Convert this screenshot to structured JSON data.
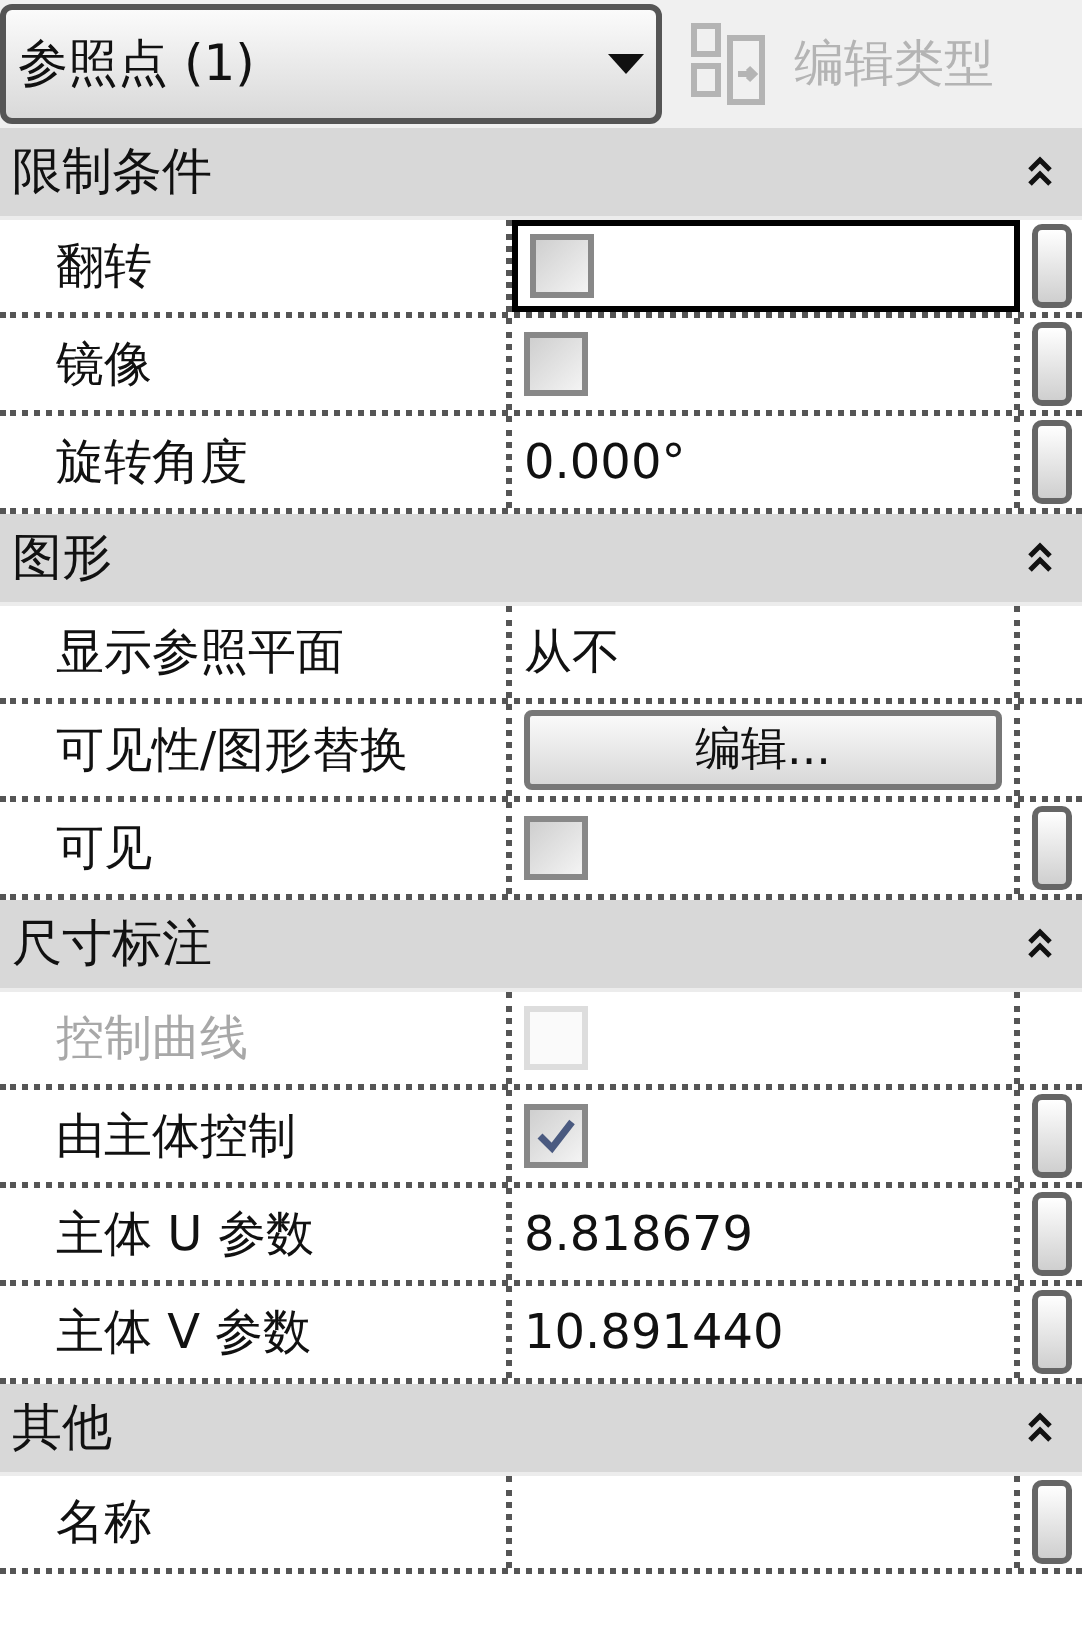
{
  "type_selector": {
    "label": "参照点 (1)"
  },
  "edit_type_button": {
    "label": "编辑类型",
    "disabled": true
  },
  "sections": [
    {
      "title": "限制条件",
      "expanded": true,
      "rows": [
        {
          "label": "翻转",
          "kind": "checkbox",
          "checked": false,
          "disabled": false,
          "selected": true,
          "param_button": true
        },
        {
          "label": "镜像",
          "kind": "checkbox",
          "checked": false,
          "disabled": false,
          "selected": false,
          "param_button": true
        },
        {
          "label": "旋转角度",
          "kind": "text",
          "value": "0.000°",
          "disabled": false,
          "selected": false,
          "param_button": true
        }
      ]
    },
    {
      "title": "图形",
      "expanded": true,
      "rows": [
        {
          "label": "显示参照平面",
          "kind": "text",
          "value": "从不",
          "disabled": false,
          "selected": false,
          "param_button": false
        },
        {
          "label": "可见性/图形替换",
          "kind": "button",
          "value": "编辑...",
          "disabled": false,
          "selected": false,
          "param_button": false
        },
        {
          "label": "可见",
          "kind": "checkbox",
          "checked": false,
          "disabled": false,
          "selected": false,
          "param_button": true
        }
      ]
    },
    {
      "title": "尺寸标注",
      "expanded": true,
      "rows": [
        {
          "label": "控制曲线",
          "kind": "checkbox",
          "checked": false,
          "disabled": true,
          "selected": false,
          "param_button": false
        },
        {
          "label": "由主体控制",
          "kind": "checkbox",
          "checked": true,
          "disabled": false,
          "selected": false,
          "param_button": true
        },
        {
          "label": "主体 U 参数",
          "kind": "text",
          "value": "8.818679",
          "disabled": false,
          "selected": false,
          "param_button": true
        },
        {
          "label": "主体 V 参数",
          "kind": "text",
          "value": "10.891440",
          "disabled": false,
          "selected": false,
          "param_button": true
        }
      ]
    },
    {
      "title": "其他",
      "expanded": true,
      "rows": [
        {
          "label": "名称",
          "kind": "text",
          "value": "",
          "disabled": false,
          "selected": false,
          "param_button": true
        }
      ]
    }
  ]
}
